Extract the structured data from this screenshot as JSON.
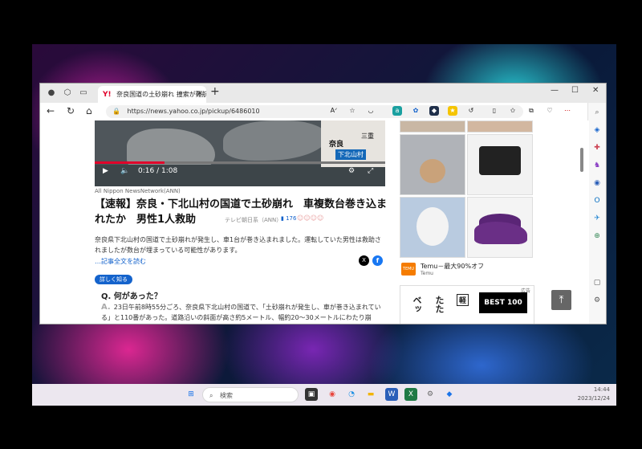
{
  "browser": {
    "tab_title": "奈良国道の土砂崩れ 捜索が難航",
    "tab_favicon": "Y!",
    "url": "https://news.yahoo.co.jp/pickup/6486010"
  },
  "video": {
    "map_label_nara": "奈良",
    "map_label_mie": "三重",
    "map_label_village": "下北山村",
    "time": "0:16 / 1:08",
    "progress": 0.24,
    "source": "All Nippon NewsNetwork(ANN)"
  },
  "article": {
    "headline": "【速報】奈良・下北山村の国道で土砂崩れ　車複数台巻き込まれたか　男性1人救助",
    "publisher": "テレビ朝日系（ANN）",
    "comment_count": "176",
    "summary": "奈良県下北山村の国道で土砂崩れが発生し、車1台が巻き込まれました。運転していた男性は救助されましたが数台が埋まっている可能性があります。",
    "read_more": "…記事全文を読む",
    "detail_pill": "詳しく知る",
    "question": "Q. 何があった？",
    "answer_mark": "A.",
    "answer": "23日午前8時55分ごろ、奈良県下北山村の国道で、「土砂崩れが発生し、車が巻き込まれている」と110番があった。道路沿いの斜面が高さ約5メートル、幅約20～30メートルにわたり崩"
  },
  "ads": {
    "temu_title": "Temu－最大90%オフ",
    "temu_sub": "Temu",
    "temu_logo": "TEMU",
    "ad_label": "広告",
    "ad2_col1": "ベッ",
    "ad2_col2": "たた",
    "ad2_tag": "軽",
    "best_label": "BEST 100"
  },
  "taskbar": {
    "search_placeholder": "検索",
    "time": "14:44",
    "date": "2023/12/24"
  }
}
